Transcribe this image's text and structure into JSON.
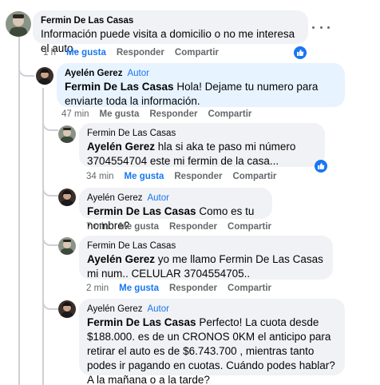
{
  "comments": [
    {
      "author": "Fermin De Las Casas",
      "badge": "",
      "mention": "",
      "text": "Información puede visita a domicilio o no me interesa el auto..",
      "time": "1 h",
      "like": "Me gusta",
      "reply": "Responder",
      "share": "Compartir",
      "liked": true
    },
    {
      "author": "Ayelén Gerez",
      "badge": "Autor",
      "mention": "Fermin De Las Casas",
      "text": " Hola! Dejame tu numero para enviarte toda la información.",
      "time": "47 min",
      "like": "Me gusta",
      "reply": "Responder",
      "share": "Compartir",
      "liked": false
    },
    {
      "author": "Fermin De Las Casas",
      "badge": "",
      "mention": "Ayelén Gerez",
      "text": " hla si aka te paso mi número 3704554704 este mi fermin de la casa...",
      "time": "34 min",
      "like": "Me gusta",
      "reply": "Responder",
      "share": "Compartir",
      "liked": true
    },
    {
      "author": "Ayelén Gerez",
      "badge": "Autor",
      "mention": "Fermin De Las Casas",
      "text": " Como es tu nombre?",
      "time": "7 min",
      "like": "Me gusta",
      "reply": "Responder",
      "share": "Compartir",
      "liked": false
    },
    {
      "author": "Fermin De Las Casas",
      "badge": "",
      "mention": "Ayelén Gerez",
      "text": " yo me llamo Fermin De Las Casas mi num.. CELULAR 3704554705..",
      "time": "2 min",
      "like": "Me gusta",
      "reply": "Responder",
      "share": "Compartir",
      "liked": true
    },
    {
      "author": "Ayelén Gerez",
      "badge": "Autor",
      "mention": "Fermin De Las Casas",
      "text": " Perfecto! La cuota desde $188.000. es de un CRONOS 0KM el anticipo para retirar el auto es de $6.743.700 , mientras tanto podes ir pagando en cuotas. Cuándo podes hablar? A la mañana o a la tarde?",
      "time": "",
      "like": "",
      "reply": "",
      "share": "",
      "liked": false
    }
  ],
  "colors": {
    "accent": "#1877f2",
    "bubble_grey": "#f0f2f5",
    "bubble_blue": "#e7f3ff",
    "meta_text": "#65676b"
  },
  "icons": {
    "more": "more-horizontal-icon",
    "like": "thumbs-up-icon"
  }
}
